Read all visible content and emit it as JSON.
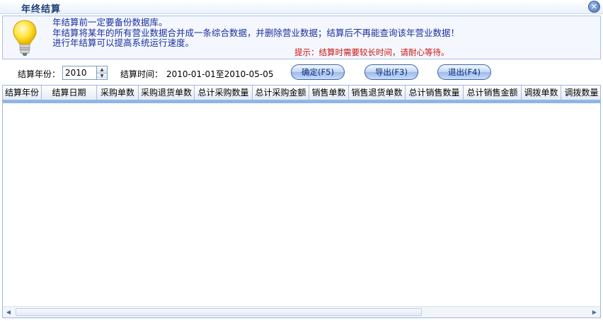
{
  "window": {
    "title": "年终结算"
  },
  "info": {
    "lines": [
      "年结算前一定要备份数据库。",
      "年结算将某年的所有营业数据合并成一条综合数据，并删除营业数据；结算后不再能查询该年营业数据！",
      "进行年结算可以提高系统运行速度。"
    ],
    "tip": "提示：结算时需要较长时间，请耐心等待。"
  },
  "toolbar": {
    "year_label": "结算年份：",
    "year_value": "2010",
    "time_label": "结算时间：",
    "time_value": "2010-01-01至2010-05-05",
    "confirm_label": "确定(F5)",
    "export_label": "导出(F3)",
    "exit_label": "退出(F4)"
  },
  "grid": {
    "columns": [
      "结算年份",
      "结算日期",
      "采购单数",
      "采购退货单数",
      "总计采购数量",
      "总计采购金额",
      "销售单数",
      "销售退货单数",
      "总计销售数量",
      "总计销售金额",
      "调拨单数",
      "调拨数量"
    ]
  },
  "colors": {
    "accent": "#1a2fa0",
    "tip": "#cc1111",
    "header_line": "#8fb4ec"
  }
}
